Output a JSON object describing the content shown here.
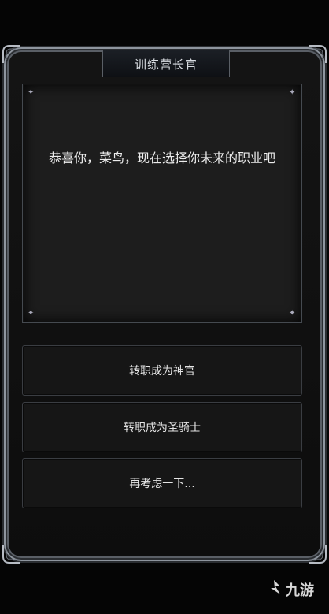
{
  "title": "训练营长官",
  "dialog": {
    "text": "恭喜你，菜鸟，现在选择你未来的职业吧"
  },
  "options": [
    {
      "label": "转职成为神官"
    },
    {
      "label": "转职成为圣骑士"
    },
    {
      "label": "再考虑一下..."
    }
  ],
  "watermark": {
    "text": "九游",
    "icon": "jiuyou-logo-icon"
  }
}
